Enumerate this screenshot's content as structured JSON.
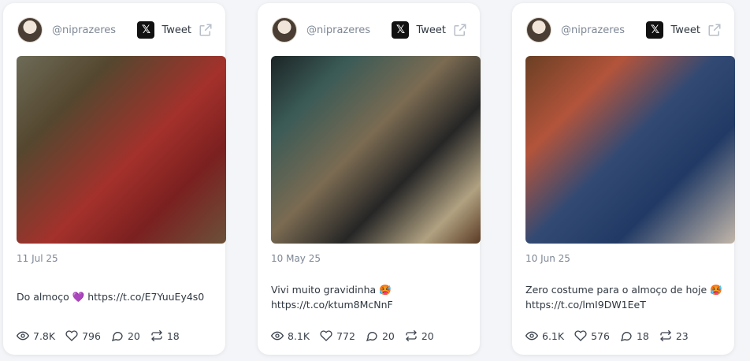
{
  "cards": [
    {
      "handle": "@niprazeres",
      "tweet_label": "Tweet",
      "date": "11 Jul 25",
      "text": "Do almoço 💜 https://t.co/E7YuuEy4s0",
      "views": "7.8K",
      "likes": "796",
      "replies": "20",
      "retweets": "18"
    },
    {
      "handle": "@niprazeres",
      "tweet_label": "Tweet",
      "date": "10 May 25",
      "text": "Vivi muito gravidinha 🥵 https://t.co/ktum8McNnF",
      "views": "8.1K",
      "likes": "772",
      "replies": "20",
      "retweets": "20"
    },
    {
      "handle": "@niprazeres",
      "tweet_label": "Tweet",
      "date": "10 Jun 25",
      "text": "Zero costume para o almoço de hoje 🥵 https://t.co/lmI9DW1EeT",
      "views": "6.1K",
      "likes": "576",
      "replies": "18",
      "retweets": "23"
    }
  ]
}
